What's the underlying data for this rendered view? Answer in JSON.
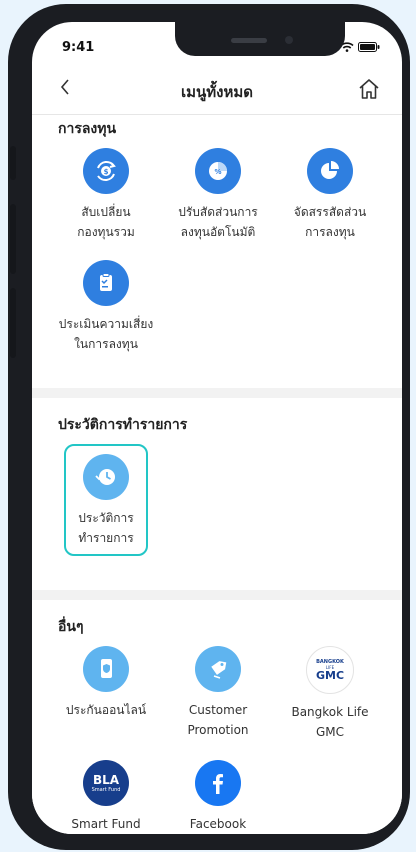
{
  "status": {
    "time": "9:41"
  },
  "header": {
    "title": "เมนูทั้งหมด"
  },
  "investment": {
    "title": "การลงทุน",
    "items": [
      {
        "label": "สับเปลี่ยน\nกองทุนรวม",
        "icon": "fund-switch-icon"
      },
      {
        "label": "ปรับสัดส่วนการ\nลงทุนอัตโนมัติ",
        "icon": "auto-rebalance-icon"
      },
      {
        "label": "จัดสรรสัดส่วน\nการลงทุน",
        "icon": "pie-chart-icon"
      },
      {
        "label": "ประเมินความเสี่ยง\nในการลงทุน",
        "icon": "risk-assessment-icon"
      }
    ]
  },
  "history": {
    "title": "ประวัติการทำรายการ",
    "items": [
      {
        "label": "ประวัติการ\nทำรายการ",
        "icon": "history-icon"
      }
    ]
  },
  "others": {
    "title": "อื่นๆ",
    "items": [
      {
        "label": "ประกันออนไลน์",
        "icon": "online-insurance-icon"
      },
      {
        "label": "Customer\nPromotion",
        "icon": "promotion-icon"
      },
      {
        "label": "Bangkok Life\nGMC",
        "icon": "bangkok-life-gmc-logo",
        "logo_top": "BANGKOK",
        "logo_mid": "LIFE",
        "logo_main": "GMC"
      },
      {
        "label": "Smart Fund",
        "icon": "smart-fund-logo",
        "logo_main": "BLA",
        "logo_sub": "Smart Fund"
      },
      {
        "label": "Facebook",
        "icon": "facebook-icon"
      }
    ]
  },
  "colors": {
    "primary": "#2f7fe0",
    "light": "#5fb4ef",
    "selected_border": "#22c6c6"
  }
}
